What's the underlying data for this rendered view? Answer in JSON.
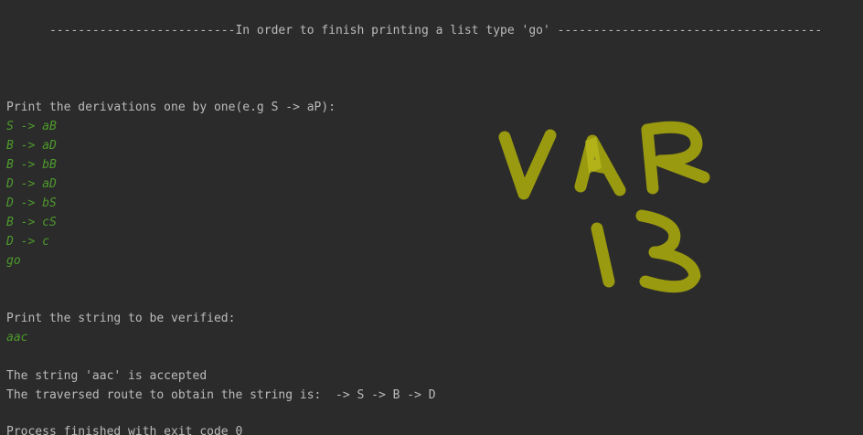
{
  "console": {
    "banner": "      --------------------------In order to finish printing a list type 'go' -------------------------------------",
    "derivations_prompt": "Print the derivations one by one(e.g S -> aP):",
    "derivations": [
      "S -> aB",
      "B -> aD",
      "B -> bB",
      "D -> aD",
      "D -> bS",
      "B -> cS",
      "D -> c",
      "go"
    ],
    "string_prompt": "Print the string to be verified:",
    "string_input": "aac",
    "result": "The string 'aac' is accepted",
    "route": "The traversed route to obtain the string is:  -> S -> B -> D",
    "exit": "Process finished with exit code 0"
  },
  "overlay": {
    "lines": [
      "VAR",
      "13"
    ],
    "color": "#9a9a10"
  },
  "colors": {
    "background": "#2b2b2b",
    "output_text": "#bbbbbb",
    "user_input": "#4e9a2c"
  }
}
